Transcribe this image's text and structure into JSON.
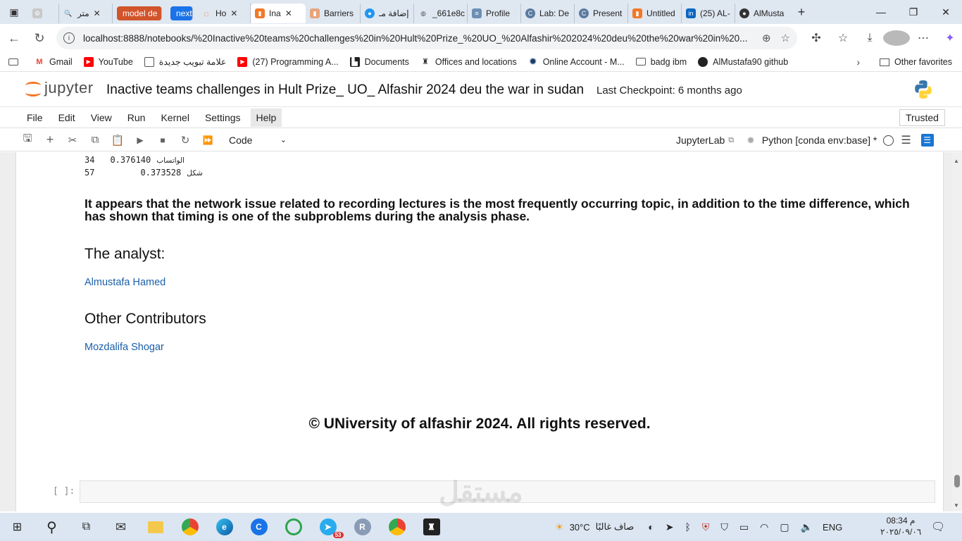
{
  "browser": {
    "tabs": [
      {
        "label": "",
        "icon": "sidebar-icon"
      },
      {
        "label": "",
        "icon": "settings-icon"
      },
      {
        "label": "متر",
        "icon": "search-icon"
      },
      {
        "label": "model de",
        "icon": "pill"
      },
      {
        "label": "next",
        "icon": "pill"
      },
      {
        "label": "Ho",
        "icon": "loading-icon"
      },
      {
        "label": "Ina",
        "icon": "notebook-icon",
        "active": true
      },
      {
        "label": "Barriers",
        "icon": "notebook-icon"
      },
      {
        "label": "إضافة مـ",
        "icon": "extension-icon"
      },
      {
        "label": "_661e8c",
        "icon": "globe-icon"
      },
      {
        "label": "Profile",
        "icon": "profile-icon"
      },
      {
        "label": "Lab: De",
        "icon": "c-icon"
      },
      {
        "label": "Present",
        "icon": "c-icon"
      },
      {
        "label": "Untitled",
        "icon": "notebook-icon"
      },
      {
        "label": "(25) AL-",
        "icon": "linkedin-icon"
      },
      {
        "label": "AlMusta",
        "icon": "github-icon"
      }
    ],
    "url": "localhost:8888/notebooks/%20Inactive%20teams%20challenges%20in%20Hult%20Prize_%20UO_%20Alfashir%202024%20deu%20the%20war%20in%20...",
    "bookmarks": [
      {
        "label": "",
        "icon": "reading-list-icon"
      },
      {
        "label": "Gmail",
        "icon": "gmail-icon"
      },
      {
        "label": "YouTube",
        "icon": "youtube-icon"
      },
      {
        "label": "علامة تبويب جديدة",
        "icon": "new-tab-icon"
      },
      {
        "label": "(27) Programming A...",
        "icon": "youtube-icon"
      },
      {
        "label": "Documents",
        "icon": "documents-icon"
      },
      {
        "label": "Offices and locations",
        "icon": "offices-icon"
      },
      {
        "label": "Online Account - M...",
        "icon": "gear-icon"
      },
      {
        "label": "badg  ibm",
        "icon": "folder-icon"
      },
      {
        "label": "AlMustafa90 github",
        "icon": "github-icon"
      }
    ],
    "other_favorites": "Other favorites"
  },
  "jupyter": {
    "logo_text": "jupyter",
    "notebook_title": "Inactive teams challenges in Hult Prize_ UO_ Alfashir 2024 deu the war in sudan",
    "checkpoint": "Last Checkpoint: 6 months ago",
    "menu": [
      "File",
      "Edit",
      "View",
      "Run",
      "Kernel",
      "Settings",
      "Help"
    ],
    "trusted": "Trusted",
    "cell_type": "Code",
    "jupyterlab_label": "JupyterLab",
    "kernel_name": "Python [conda env:base] *"
  },
  "notebook": {
    "output_rows": [
      {
        "index": "34",
        "value": "0.376140",
        "word": "الواتساب"
      },
      {
        "index": "57",
        "value": "0.373528",
        "word": "شكل"
      }
    ],
    "paragraph": "It appears that the network issue related to recording lectures is the most frequently occurring topic, in addition to the time difference, which has shown that timing is one of the subproblems during the analysis phase.",
    "analyst_heading": "The analyst:",
    "analyst_name": "Almustafa Hamed",
    "contributors_heading": "Other Contributors",
    "contributor_name": "Mozdalifa Shogar",
    "copyright": "© UNiversity of alfashir 2024. All rights reserved.",
    "prompt": "[ ]:",
    "watermark": "مستقل"
  },
  "taskbar": {
    "weather_temp": "30°C",
    "weather_text": "صاف غالبًا",
    "lang": "ENG",
    "time": "08:34 م",
    "date": "٢٠٢٥/٠٩/٠٦",
    "badge": "53"
  }
}
